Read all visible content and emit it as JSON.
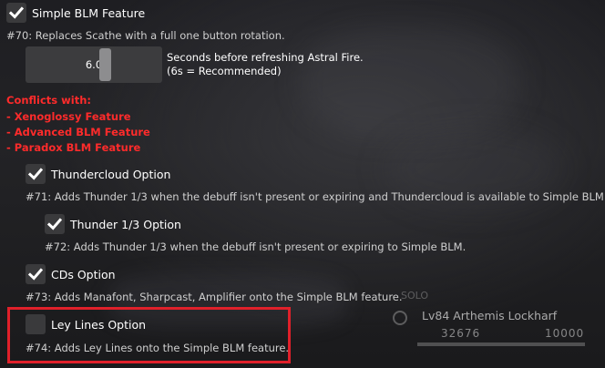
{
  "colors": {
    "conflict_text": "#ff2b2b",
    "highlight_border": "#e0202a",
    "checkbox_bg": "#3a3a3c",
    "checkmark": "#ffffff"
  },
  "feature": {
    "label": "Simple BLM Feature",
    "checked": true,
    "description": "#70: Replaces Scathe with a full one button rotation."
  },
  "slider": {
    "value": "6.0",
    "fraction": 0.6,
    "caption_line1": "Seconds before refreshing Astral Fire.",
    "caption_line2": "(6s = Recommended)"
  },
  "conflicts": {
    "header": "Conflicts with:",
    "items": [
      " - Xenoglossy Feature",
      " - Advanced BLM Feature",
      " - Paradox BLM Feature"
    ]
  },
  "options": [
    {
      "label": "Thundercloud Option",
      "checked": true,
      "description": "#71: Adds Thunder 1/3 when the debuff isn't present or expiring and Thundercloud is available to Simple BLM."
    },
    {
      "label": "Thunder 1/3 Option",
      "checked": true,
      "description": "#72: Adds Thunder 1/3 when the debuff isn't present or expiring to Simple BLM."
    },
    {
      "label": "CDs Option",
      "checked": true,
      "description": "#73: Adds Manafont, Sharpcast, Amplifier onto the Simple BLM feature."
    },
    {
      "label": "Ley Lines Option",
      "checked": false,
      "description": "#74: Adds Ley Lines onto the Simple BLM feature."
    }
  ],
  "hud": {
    "party_label": "SOLO",
    "player_name": "Lv84 Arthemis Lockharf",
    "hp": "32676",
    "mp": "10000"
  }
}
